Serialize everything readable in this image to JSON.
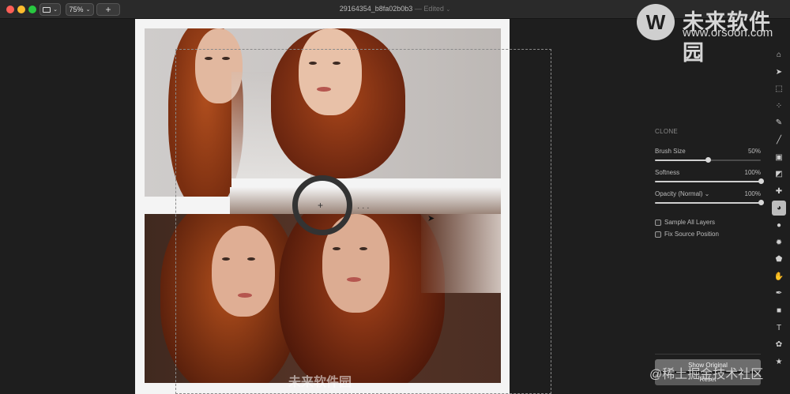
{
  "window": {
    "title": "29164354_b8fa02b0b3",
    "status": "— Edited",
    "zoom": "75%",
    "add_label": "+"
  },
  "watermark": {
    "logo_char": "W",
    "title": "未来软件园",
    "url": "www.orsoon.com",
    "bottom_text": "@稀土掘金技术社区",
    "canvas_text": "未来软件园"
  },
  "panel": {
    "section": "CLONE",
    "sliders": [
      {
        "label": "Brush Size",
        "value": "50%",
        "fraction": 0.5
      },
      {
        "label": "Softness",
        "value": "100%",
        "fraction": 1.0
      },
      {
        "label": "Opacity (Normal) ⌄",
        "value": "100%",
        "fraction": 1.0
      }
    ],
    "checkboxes": [
      {
        "label": "Sample All Layers",
        "checked": false
      },
      {
        "label": "Fix Source Position",
        "checked": false
      }
    ],
    "show_original": "Show Original",
    "reset": "Reset"
  },
  "tools": [
    {
      "name": "arrange-tool-icon",
      "glyph": "⌂"
    },
    {
      "name": "select-arrow-icon",
      "glyph": "➤"
    },
    {
      "name": "rect-select-icon",
      "glyph": "⬚"
    },
    {
      "name": "quick-select-icon",
      "glyph": "⁘"
    },
    {
      "name": "color-picker-icon",
      "glyph": "✎"
    },
    {
      "name": "brush-icon",
      "glyph": "╱"
    },
    {
      "name": "bucket-icon",
      "glyph": "▣"
    },
    {
      "name": "eraser-icon",
      "glyph": "◩"
    },
    {
      "name": "retouch-icon",
      "glyph": "✚"
    },
    {
      "name": "clone-stamp-icon",
      "glyph": "◕",
      "active": true
    },
    {
      "name": "blur-icon",
      "glyph": "●"
    },
    {
      "name": "light-icon",
      "glyph": "✹"
    },
    {
      "name": "shape-blob-icon",
      "glyph": "⬟"
    },
    {
      "name": "hand-icon",
      "glyph": "✋"
    },
    {
      "name": "pen-icon",
      "glyph": "✒"
    },
    {
      "name": "rectangle-icon",
      "glyph": "■"
    },
    {
      "name": "text-icon",
      "glyph": "T"
    },
    {
      "name": "effects-icon",
      "glyph": "✿"
    },
    {
      "name": "star-icon",
      "glyph": "★"
    }
  ]
}
